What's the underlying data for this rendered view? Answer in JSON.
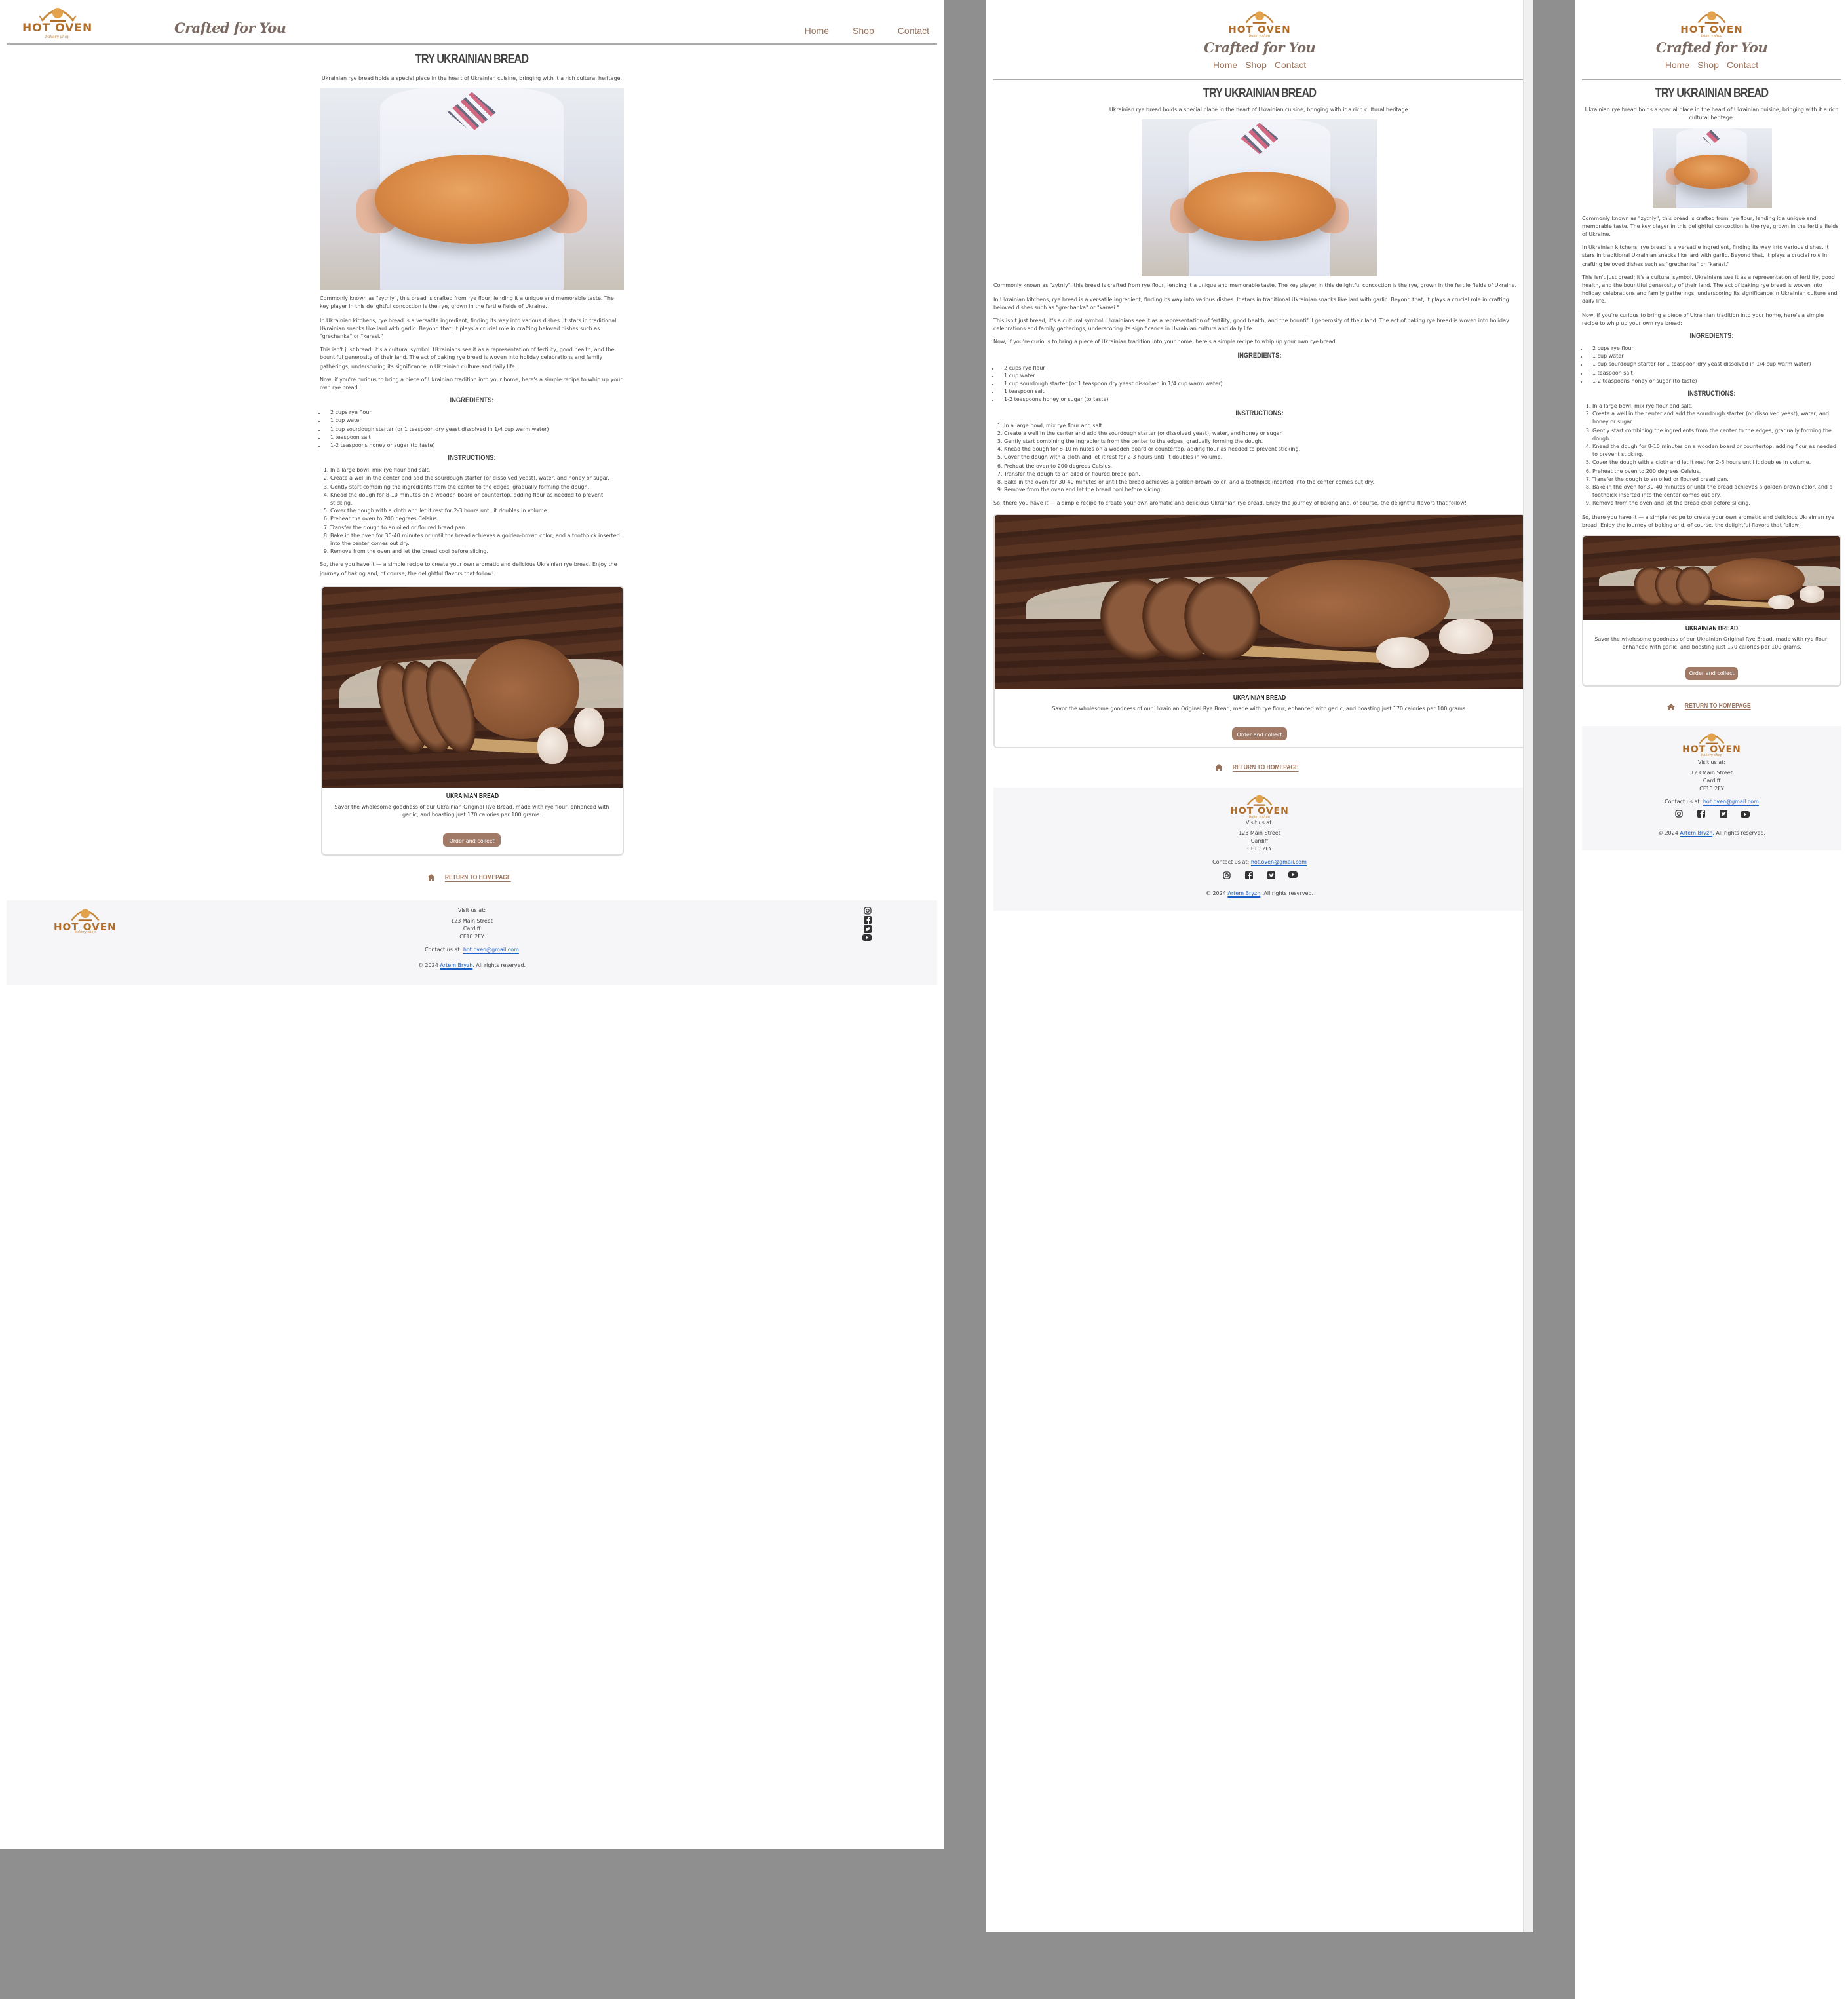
{
  "brand": {
    "name": "HOT OVEN",
    "sub": "bakery shop",
    "tagline": "Crafted for You"
  },
  "nav": [
    "Home",
    "Shop",
    "Contact"
  ],
  "article": {
    "title": "TRY UKRAINIAN BREAD",
    "intro": "Ukrainian rye bread holds a special place in the heart of Ukrainian cuisine, bringing with it a rich cultural heritage.",
    "paragraphs": [
      "Commonly known as \"zytniy\", this bread is crafted from rye flour, lending it a unique and memorable taste. The key player in this delightful concoction is the rye, grown in the fertile fields of Ukraine.",
      "In Ukrainian kitchens, rye bread is a versatile ingredient, finding its way into various dishes. It stars in traditional Ukrainian snacks like lard with garlic. Beyond that, it plays a crucial role in crafting beloved dishes such as \"grechanka\" or \"karasi.\"",
      "This isn't just bread; it's a cultural symbol. Ukrainians see it as a representation of fertility, good health, and the bountiful generosity of their land. The act of baking rye bread is woven into holiday celebrations and family gatherings, underscoring its significance in Ukrainian culture and daily life.",
      "Now, if you're curious to bring a piece of Ukrainian tradition into your home, here's a simple recipe to whip up your own rye bread:"
    ],
    "ingredients_heading": "INGREDIENTS:",
    "ingredients": [
      "2 cups rye flour",
      "1 cup water",
      "1 cup sourdough starter (or 1 teaspoon dry yeast dissolved in 1/4 cup warm water)",
      "1 teaspoon salt",
      "1-2 teaspoons honey or sugar (to taste)"
    ],
    "instructions_heading": "INSTRUCTIONS:",
    "instructions": [
      "In a large bowl, mix rye flour and salt.",
      "Create a well in the center and add the sourdough starter (or dissolved yeast), water, and honey or sugar.",
      "Gently start combining the ingredients from the center to the edges, gradually forming the dough.",
      "Knead the dough for 8-10 minutes on a wooden board or countertop, adding flour as needed to prevent sticking.",
      "Cover the dough with a cloth and let it rest for 2-3 hours until it doubles in volume.",
      "Preheat the oven to 200 degrees Celsius.",
      "Transfer the dough to an oiled or floured bread pan.",
      "Bake in the oven for 30-40 minutes or until the bread achieves a golden-brown color, and a toothpick inserted into the center comes out dry.",
      "Remove from the oven and let the bread cool before slicing."
    ],
    "closing": "So, there you have it — a simple recipe to create your own aromatic and delicious Ukrainian rye bread. Enjoy the journey of baking and, of course, the delightful flavors that follow!"
  },
  "card": {
    "title": "UKRAINIAN BREAD",
    "text": "Savor the wholesome goodness of our Ukrainian Original Rye Bread, made with rye flour, enhanced with garlic, and boasting just 170 calories per 100 grams.",
    "button": "Order and collect"
  },
  "return_link": "RETURN TO HOMEPAGE",
  "footer": {
    "visit": "Visit us at:",
    "address": [
      "123 Main Street",
      "Cardiff",
      "CF10 2FY"
    ],
    "contact_prefix": "Contact us at:",
    "email": "hot.oven@gmail.com",
    "copyright_prefix": "© 2024",
    "author": "Artem Bryzh",
    "copyright_suffix": ". All rights reserved.",
    "social": [
      "instagram-icon",
      "facebook-icon",
      "twitter-icon",
      "youtube-icon"
    ]
  },
  "colors": {
    "accent": "#a07a67",
    "nav": "#9a735c",
    "logo": "#c98a3c",
    "link": "#1a5fc7",
    "background": "#8f8f8f"
  }
}
